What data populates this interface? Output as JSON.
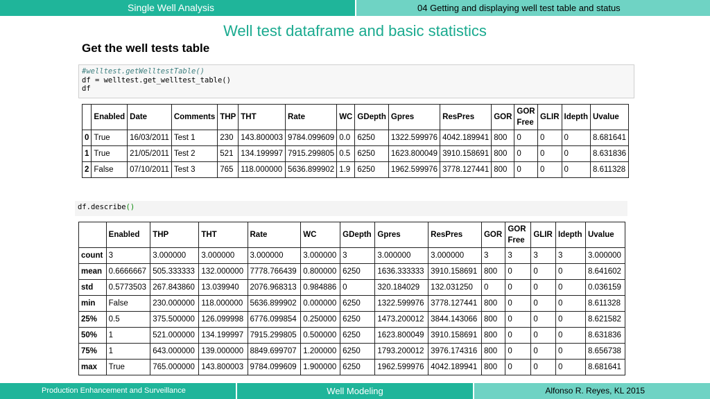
{
  "header": {
    "left_title": "Single Well Analysis",
    "right_title": "04 Getting and displaying well test table and status"
  },
  "slide_title": "Well test dataframe and basic statistics",
  "section_title": "Get the well tests table",
  "code_cell_1": {
    "comment": "#welltest.getWelltestTable()",
    "line2": "df = welltest.get_welltest_table()",
    "line3": "df"
  },
  "code_cell_2": {
    "prefix": "df.describe",
    "parens": "()"
  },
  "table1": {
    "headers": [
      "",
      "Enabled",
      "Date",
      "Comments",
      "THP",
      "THT",
      "Rate",
      "WC",
      "GDepth",
      "Gpres",
      "ResPres",
      "GOR",
      "GOR Free",
      "GLIR",
      "Idepth",
      "Uvalue"
    ],
    "rows": [
      [
        "0",
        "True",
        "16/03/2011",
        "Test 1",
        "230",
        "143.800003",
        "9784.099609",
        "0.0",
        "6250",
        "1322.599976",
        "4042.189941",
        "800",
        "0",
        "0",
        "0",
        "8.681641"
      ],
      [
        "1",
        "True",
        "21/05/2011",
        "Test 2",
        "521",
        "134.199997",
        "7915.299805",
        "0.5",
        "6250",
        "1623.800049",
        "3910.158691",
        "800",
        "0",
        "0",
        "0",
        "8.631836"
      ],
      [
        "2",
        "False",
        "07/10/2011",
        "Test 3",
        "765",
        "118.000000",
        "5636.899902",
        "1.9",
        "6250",
        "1962.599976",
        "3778.127441",
        "800",
        "0",
        "0",
        "0",
        "8.611328"
      ]
    ]
  },
  "table2": {
    "headers": [
      "",
      "Enabled",
      "THP",
      "THT",
      "Rate",
      "WC",
      "GDepth",
      "Gpres",
      "ResPres",
      "GOR",
      "GOR Free",
      "GLIR",
      "Idepth",
      "Uvalue"
    ],
    "rows": [
      [
        "count",
        "3",
        "3.000000",
        "3.000000",
        "3.000000",
        "3.000000",
        "3",
        "3.000000",
        "3.000000",
        "3",
        "3",
        "3",
        "3",
        "3.000000"
      ],
      [
        "mean",
        "0.6666667",
        "505.333333",
        "132.000000",
        "7778.766439",
        "0.800000",
        "6250",
        "1636.333333",
        "3910.158691",
        "800",
        "0",
        "0",
        "0",
        "8.641602"
      ],
      [
        "std",
        "0.5773503",
        "267.843860",
        "13.039940",
        "2076.968313",
        "0.984886",
        "0",
        "320.184029",
        "132.031250",
        "0",
        "0",
        "0",
        "0",
        "0.036159"
      ],
      [
        "min",
        "False",
        "230.000000",
        "118.000000",
        "5636.899902",
        "0.000000",
        "6250",
        "1322.599976",
        "3778.127441",
        "800",
        "0",
        "0",
        "0",
        "8.611328"
      ],
      [
        "25%",
        "0.5",
        "375.500000",
        "126.099998",
        "6776.099854",
        "0.250000",
        "6250",
        "1473.200012",
        "3844.143066",
        "800",
        "0",
        "0",
        "0",
        "8.621582"
      ],
      [
        "50%",
        "1",
        "521.000000",
        "134.199997",
        "7915.299805",
        "0.500000",
        "6250",
        "1623.800049",
        "3910.158691",
        "800",
        "0",
        "0",
        "0",
        "8.631836"
      ],
      [
        "75%",
        "1",
        "643.000000",
        "139.000000",
        "8849.699707",
        "1.200000",
        "6250",
        "1793.200012",
        "3976.174316",
        "800",
        "0",
        "0",
        "0",
        "8.656738"
      ],
      [
        "max",
        "True",
        "765.000000",
        "143.800003",
        "9784.099609",
        "1.900000",
        "6250",
        "1962.599976",
        "4042.189941",
        "800",
        "0",
        "0",
        "0",
        "8.681641"
      ]
    ]
  },
  "footer": {
    "left": "Production Enhancement and Surveillance",
    "middle": "Well Modeling",
    "right": "Alfonso R. Reyes, KL 2015"
  }
}
